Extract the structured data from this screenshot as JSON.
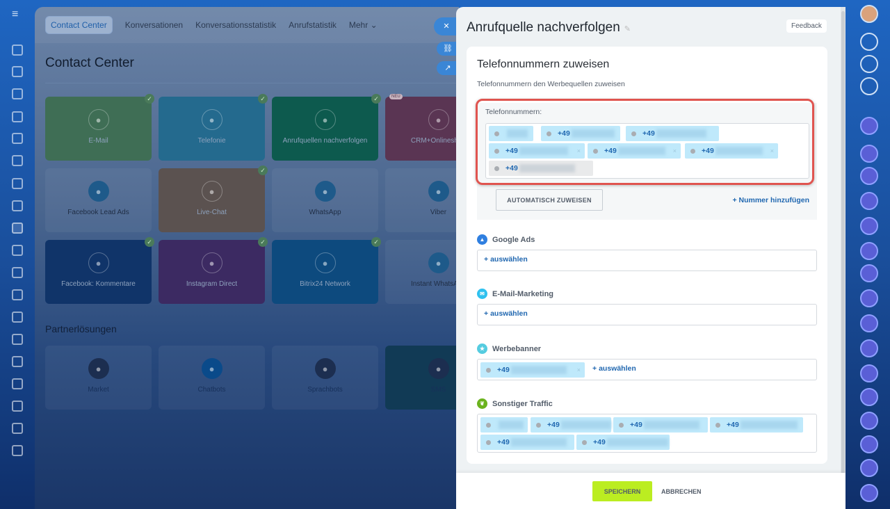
{
  "background": {
    "tabs": [
      "Contact Center",
      "Konversationen",
      "Konversationsstatistik",
      "Anrufstatistik",
      "Mehr"
    ],
    "page_title": "Contact Center",
    "tiles": [
      {
        "label": "E-Mail",
        "icon": "mail-icon",
        "color": "#3f6e55",
        "checked": true
      },
      {
        "label": "Telefonie",
        "icon": "phone-icon",
        "color": "#246a8e",
        "checked": true
      },
      {
        "label": "Anrufquellen nachverfolgen",
        "icon": "call-tracking-icon",
        "color": "#0d5a4e",
        "checked": true
      },
      {
        "label": "CRM+Onlineshop",
        "icon": "shop-icon",
        "color": "#5a3553",
        "checked": false,
        "badge": "NEU"
      },
      {
        "label": "Facebook Lead Ads",
        "icon": "facebook-leads-icon",
        "color": "",
        "checked": false
      },
      {
        "label": "Live-Chat",
        "icon": "chat-icon",
        "color": "#5b5250",
        "checked": true
      },
      {
        "label": "WhatsApp",
        "icon": "whatsapp-icon",
        "color": "",
        "checked": false
      },
      {
        "label": "Viber",
        "icon": "viber-icon",
        "color": "",
        "checked": false
      },
      {
        "label": "Facebook: Kommentare",
        "icon": "facebook-comments-icon",
        "color": "#103469",
        "checked": true
      },
      {
        "label": "Instagram Direct",
        "icon": "instagram-icon",
        "color": "#3c2a62",
        "checked": true
      },
      {
        "label": "Bitrix24 Network",
        "icon": "cloud-icon",
        "color": "#0d4a7e",
        "checked": true
      },
      {
        "label": "Instant WhatsApp",
        "icon": "whatsapp-icon",
        "color": "",
        "checked": false
      }
    ],
    "partner_title": "Partnerlösungen",
    "partners": [
      {
        "label": "Market",
        "icon": "market-icon"
      },
      {
        "label": "Chatbots",
        "icon": "robot-icon"
      },
      {
        "label": "Sprachbots",
        "icon": "microphone-icon"
      },
      {
        "label": "SMS",
        "icon": "sms-icon"
      }
    ]
  },
  "panel": {
    "title": "Anrufquelle nachverfolgen",
    "feedback": "Feedback",
    "card_title": "Telefonnummern zuweisen",
    "card_subtitle": "Telefonnummern den Werbequellen zuweisen",
    "numbers_label": "Telefonnummern:",
    "numbers": [
      "",
      "+49",
      "+49",
      "+49",
      "+49",
      "+49",
      "+49"
    ],
    "auto_assign": "AUTOMATISCH ZUWEISEN",
    "add_number": "+ Nummer hinzufügen",
    "sources": [
      {
        "name": "Google Ads",
        "icon_color": "#2f7fe0",
        "numbers": [],
        "select": "auswählen"
      },
      {
        "name": "E-Mail-Marketing",
        "icon_color": "#2fc1ef",
        "numbers": [],
        "select": "auswählen"
      },
      {
        "name": "Werbebanner",
        "icon_color": "#55cce0",
        "numbers": [
          "+49"
        ],
        "select": "auswählen"
      },
      {
        "name": "Sonstiger Traffic",
        "icon_color": "#6bb31e",
        "numbers": [
          "",
          "+49",
          "+49",
          "+49",
          "+49",
          "+49"
        ],
        "select": ""
      }
    ],
    "save": "SPEICHERN",
    "cancel": "ABBRECHEN"
  }
}
